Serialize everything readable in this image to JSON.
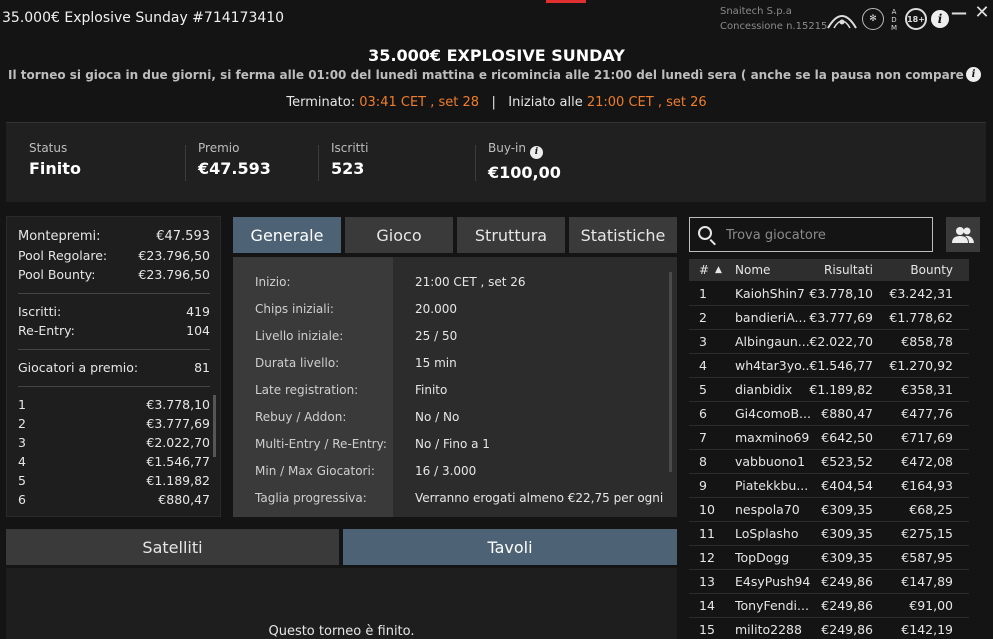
{
  "window": {
    "title": "35.000€ Explosive Sunday #714173410",
    "company": "Snaitech S.p.a",
    "concession": "Concessione n.15215",
    "badges": {
      "adm": "ADM",
      "aams": [
        "A",
        "D",
        "M"
      ],
      "age": "18+",
      "info": "i"
    }
  },
  "header": {
    "title": "35.000€ EXPLOSIVE SUNDAY",
    "description": "Il torneo si gioca in due giorni, si ferma alle 01:00 del lunedì mattina e ricomincia alle 21:00 del lunedì sera ( anche se la pausa non compare nella lobby)....",
    "ended_label": "Terminato:",
    "ended_value": "03:41 CET , set 28",
    "divider": "|",
    "started_label": "Iniziato alle",
    "started_value": "21:00 CET , set 26"
  },
  "stats": [
    {
      "label": "Status",
      "value": "Finito"
    },
    {
      "label": "Premio",
      "value": "€47.593"
    },
    {
      "label": "Iscritti",
      "value": "523"
    },
    {
      "label": "Buy-in",
      "value": "€100,00"
    }
  ],
  "prize_panel": {
    "montepremi": {
      "label": "Montepremi:",
      "value": "€47.593"
    },
    "pool_regolare": {
      "label": "Pool Regolare:",
      "value": "€23.796,50"
    },
    "pool_bounty": {
      "label": "Pool Bounty:",
      "value": "€23.796,50"
    },
    "iscritti": {
      "label": "Iscritti:",
      "value": "419"
    },
    "reentry": {
      "label": "Re-Entry:",
      "value": "104"
    },
    "giocatori_premio": {
      "label": "Giocatori a premio:",
      "value": "81"
    },
    "payouts": [
      {
        "pos": "1",
        "amount": "€3.778,10"
      },
      {
        "pos": "2",
        "amount": "€3.777,69"
      },
      {
        "pos": "3",
        "amount": "€2.022,70"
      },
      {
        "pos": "4",
        "amount": "€1.546,77"
      },
      {
        "pos": "5",
        "amount": "€1.189,82"
      },
      {
        "pos": "6",
        "amount": "€880,47"
      }
    ]
  },
  "tabs": [
    "Generale",
    "Gioco",
    "Struttura",
    "Statistiche"
  ],
  "details": [
    {
      "k": "Inizio:",
      "v": "21:00 CET , set 26"
    },
    {
      "k": "Chips iniziali:",
      "v": "20.000"
    },
    {
      "k": "Livello iniziale:",
      "v": "25 / 50"
    },
    {
      "k": "Durata livello:",
      "v": "15 min"
    },
    {
      "k": "Late registration:",
      "v": "Finito"
    },
    {
      "k": "Rebuy / Addon:",
      "v": "No / No"
    },
    {
      "k": "Multi-Entry / Re-Entry:",
      "v": "No / Fino a 1"
    },
    {
      "k": "Min / Max Giocatori:",
      "v": "16 / 3.000"
    },
    {
      "k": "Taglia progressiva:",
      "v": "Verranno erogati almeno €22,75 per ogni"
    }
  ],
  "bottom_tabs": [
    "Satelliti",
    "Tavoli"
  ],
  "finished_message": "Questo torneo è finito.",
  "search": {
    "placeholder": "Trova giocatore"
  },
  "players_table": {
    "headers": {
      "rank": "#",
      "sort": "▲",
      "name": "Nome",
      "results": "Risultati",
      "bounty": "Bounty"
    },
    "rows": [
      {
        "rank": "1",
        "name": "KaiohShin7",
        "results": "€3.778,10",
        "bounty": "€3.242,31"
      },
      {
        "rank": "2",
        "name": "bandieriA...",
        "results": "€3.777,69",
        "bounty": "€1.778,62"
      },
      {
        "rank": "3",
        "name": "Albingaun...",
        "results": "€2.022,70",
        "bounty": "€858,78"
      },
      {
        "rank": "4",
        "name": "wh4tar3yo...",
        "results": "€1.546,77",
        "bounty": "€1.270,92"
      },
      {
        "rank": "5",
        "name": "dianbidix",
        "results": "€1.189,82",
        "bounty": "€358,31"
      },
      {
        "rank": "6",
        "name": "Gi4comoB...",
        "results": "€880,47",
        "bounty": "€477,76"
      },
      {
        "rank": "7",
        "name": "maxmino69",
        "results": "€642,50",
        "bounty": "€717,69"
      },
      {
        "rank": "8",
        "name": "vabbuono1",
        "results": "€523,52",
        "bounty": "€472,08"
      },
      {
        "rank": "9",
        "name": "Piatekkbu...",
        "results": "€404,54",
        "bounty": "€164,93"
      },
      {
        "rank": "10",
        "name": "nespola70",
        "results": "€309,35",
        "bounty": "€68,25"
      },
      {
        "rank": "11",
        "name": "LoSplasho",
        "results": "€309,35",
        "bounty": "€275,15"
      },
      {
        "rank": "12",
        "name": "TopDogg",
        "results": "€309,35",
        "bounty": "€587,95"
      },
      {
        "rank": "13",
        "name": "E4syPush94",
        "results": "€249,86",
        "bounty": "€147,89"
      },
      {
        "rank": "14",
        "name": "TonyFendi...",
        "results": "€249,86",
        "bounty": "€91,00"
      },
      {
        "rank": "15",
        "name": "milito2288",
        "results": "€249,86",
        "bounty": "€142,19"
      }
    ]
  },
  "colors": {
    "accent_orange": "#ef7d2a",
    "active_tab": "#4d6275",
    "background": "#141414"
  }
}
